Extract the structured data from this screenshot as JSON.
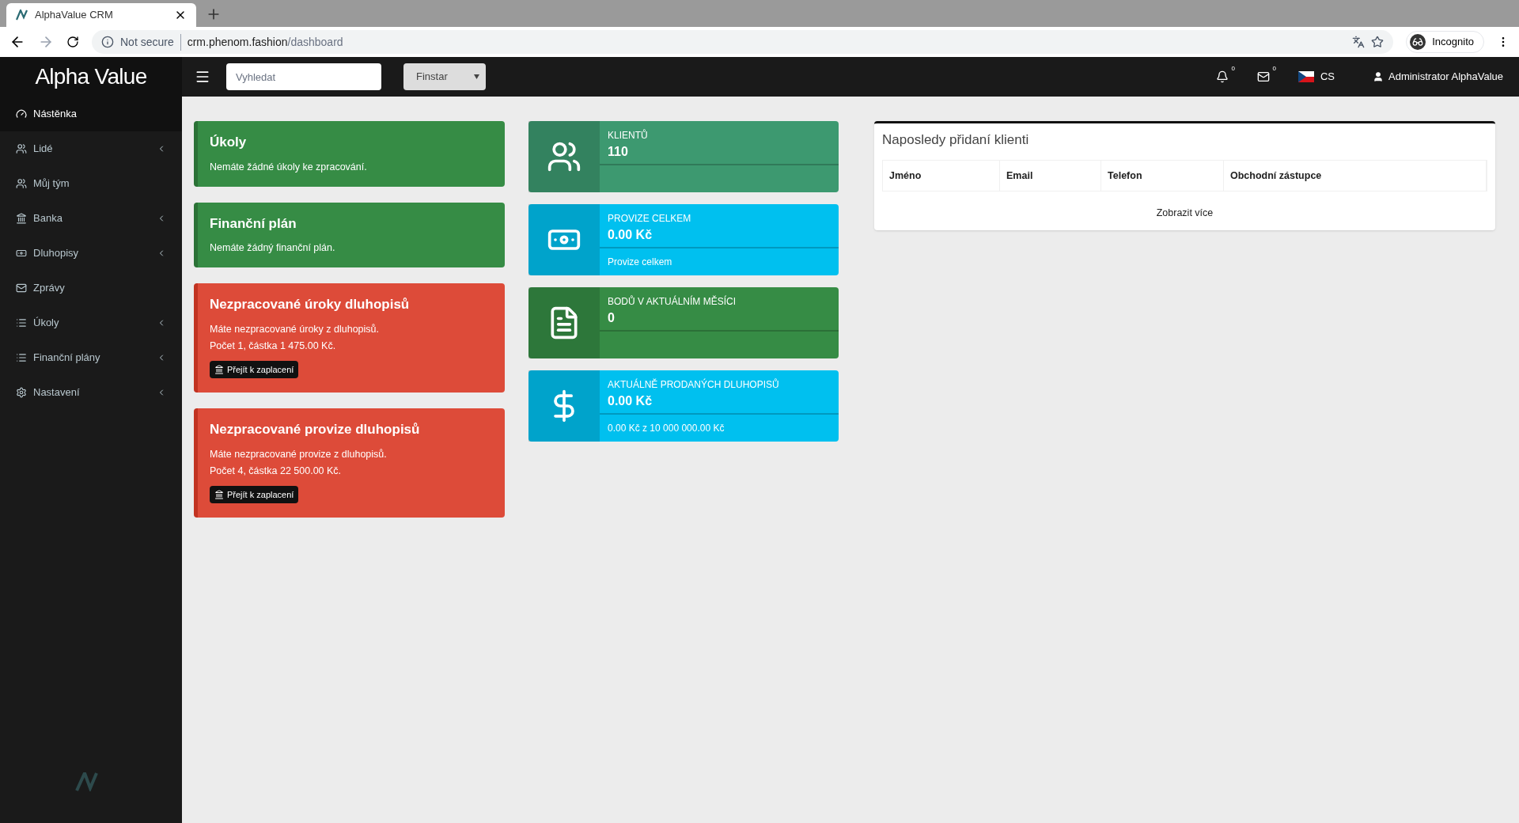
{
  "browser": {
    "tab_title": "AlphaValue CRM",
    "security": "Not secure",
    "url_host": "crm.phenom.fashion",
    "url_path": "/dashboard",
    "profile": "Incognito"
  },
  "header": {
    "logo": "Alpha Value",
    "search": {
      "placeholder": "Vyhledat"
    },
    "select": {
      "value": "Finstar"
    },
    "notifications": "0",
    "messages": "0",
    "language": "CS",
    "user": "Administrator AlphaValue"
  },
  "sidebar": {
    "items": [
      {
        "label": "Nástěnka",
        "kind": "dashboard",
        "selected": true,
        "expandable": false
      },
      {
        "label": "Lidé",
        "kind": "users",
        "selected": false,
        "expandable": true
      },
      {
        "label": "Můj tým",
        "kind": "users",
        "selected": false,
        "expandable": false
      },
      {
        "label": "Banka",
        "kind": "bank",
        "selected": false,
        "expandable": true
      },
      {
        "label": "Dluhopisy",
        "kind": "money",
        "selected": false,
        "expandable": true
      },
      {
        "label": "Zprávy",
        "kind": "mail",
        "selected": false,
        "expandable": false
      },
      {
        "label": "Úkoly",
        "kind": "list",
        "selected": false,
        "expandable": true
      },
      {
        "label": "Finanční plány",
        "kind": "list",
        "selected": false,
        "expandable": true
      },
      {
        "label": "Nastavení",
        "kind": "gear",
        "selected": false,
        "expandable": true
      }
    ]
  },
  "alerts": [
    {
      "kind": "success",
      "title": "Úkoly",
      "lines": [
        "Nemáte žádné úkoly ke zpracování."
      ]
    },
    {
      "kind": "success",
      "title": "Finanční plán",
      "lines": [
        "Nemáte žádný finanční plán."
      ]
    },
    {
      "kind": "danger",
      "title": "Nezpracované úroky dluhopisů",
      "lines": [
        "Máte nezpracované úroky z dluhopisů.",
        "Počet 1, částka 1 475.00 Kč."
      ],
      "button": "Přejít k zaplacení"
    },
    {
      "kind": "danger",
      "title": "Nezpracované provize dluhopisů",
      "lines": [
        "Máte nezpracované provize z dluhopisů.",
        "Počet 4, částka 22 500.00 Kč."
      ],
      "button": "Přejít k zaplacení"
    }
  ],
  "info_boxes": [
    {
      "kind": "users",
      "color": "#3d9970",
      "label": "KLIENTŮ",
      "value": "110"
    },
    {
      "kind": "money",
      "color": "#00c0ef",
      "label": "PROVIZE CELKEM",
      "value": "0.00 Kč",
      "footer": "Provize celkem"
    },
    {
      "kind": "document",
      "color": "#368c45",
      "label": "BODŮ V AKTUÁLNÍM MĚSÍCI",
      "value": "0"
    },
    {
      "kind": "dollar",
      "color": "#00c0ef",
      "label": "AKTUÁLNĚ PRODANÝCH DLUHOPISŮ",
      "value": "0.00 Kč",
      "footer": "0.00 Kč z 10 000 000.00 Kč"
    }
  ],
  "recent_clients": {
    "title": "Naposledy přidaní klienti",
    "columns": [
      "Jméno",
      "Email",
      "Telefon",
      "Obchodní zástupce"
    ],
    "more_link": "Zobrazit více"
  }
}
